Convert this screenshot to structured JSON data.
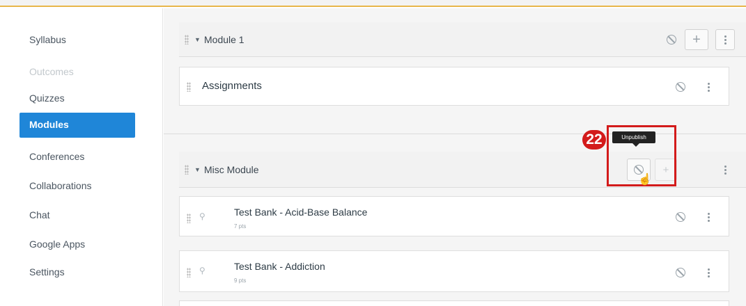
{
  "sidebar": {
    "items": [
      {
        "label": "Syllabus",
        "state": "normal"
      },
      {
        "label": "Outcomes",
        "state": "dim"
      },
      {
        "label": "Quizzes",
        "state": "normal"
      },
      {
        "label": "Modules",
        "state": "active"
      },
      {
        "label": "Conferences",
        "state": "normal"
      },
      {
        "label": "Collaborations",
        "state": "normal"
      },
      {
        "label": "Chat",
        "state": "normal"
      },
      {
        "label": "Google Apps",
        "state": "normal"
      },
      {
        "label": "Settings",
        "state": "normal"
      }
    ]
  },
  "modules": [
    {
      "title": "Module 1",
      "items": [
        {
          "title": "Assignments"
        }
      ]
    },
    {
      "title": "Misc Module",
      "items": [
        {
          "title": "Test Bank - Acid-Base Balance",
          "sub": "7 pts"
        },
        {
          "title": "Test Bank - Addiction",
          "sub": "9 pts"
        }
      ]
    }
  ],
  "annotation": {
    "step": "22",
    "tooltip": "Unpublish"
  },
  "colors": {
    "accent": "#1f86d8",
    "highlight": "#d31b1b",
    "top_border": "#e8b64a"
  }
}
